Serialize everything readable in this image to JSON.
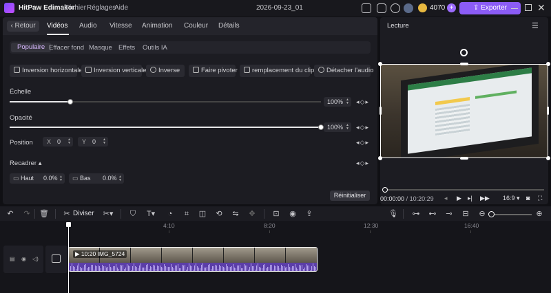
{
  "titlebar": {
    "app_name": "HitPaw Edimakor",
    "menus": [
      "Fichier",
      "Réglages",
      "Aide"
    ],
    "project_name": "2026-09-23_01",
    "credits": "4070",
    "export_label": "Exporter",
    "plus": "+"
  },
  "editor": {
    "back_label": "Retour",
    "tabs": [
      "Vidéos",
      "Audio",
      "Vitesse",
      "Animation",
      "Couleur",
      "Détails"
    ],
    "active_tab": "Vidéos",
    "subtabs": [
      "Populaire",
      "Effacer fond",
      "Masque",
      "Effets",
      "Outils IA"
    ],
    "actions": [
      "Inversion horizontale",
      "Inversion verticale",
      "Inverse",
      "Faire pivoter",
      "remplacement du clip",
      "Détacher l'audio"
    ],
    "scale": {
      "label": "Échelle",
      "value": "100%",
      "fraction": 0.195
    },
    "opacity": {
      "label": "Opacité",
      "value": "100%",
      "fraction": 1.0
    },
    "position": {
      "label": "Position",
      "x_label": "X",
      "x_value": "0",
      "y_label": "Y",
      "y_value": "0"
    },
    "crop": {
      "label": "Recadrer",
      "top_label": "Haut",
      "top_value": "0.0%",
      "bottom_label": "Bas",
      "bottom_value": "0.0%"
    },
    "keyframe_glyphs": "◂◇▸",
    "reset_label": "Réinitialiser"
  },
  "preview": {
    "title": "Lecture",
    "current_time": "00:00:00",
    "total_time": "/ 10:20:29",
    "aspect": "16:9"
  },
  "toolbar": {
    "split_label": "Diviser"
  },
  "timeline": {
    "ruler": [
      "4:10",
      "8:20",
      "12:30",
      "16:40"
    ],
    "clip_label": "10:20 IMG_5724",
    "zoom_fraction": 0.0
  },
  "colors": {
    "accent": "#8b5cf6",
    "active_subtab_text": "#d8b8ff",
    "waveform": "#5b3ea8"
  },
  "icons": {
    "back": "chevron-left-icon",
    "menu": "hamburger-icon",
    "undo": "undo-icon",
    "redo": "redo-icon",
    "delete": "trash-icon",
    "split": "scissors-icon"
  }
}
